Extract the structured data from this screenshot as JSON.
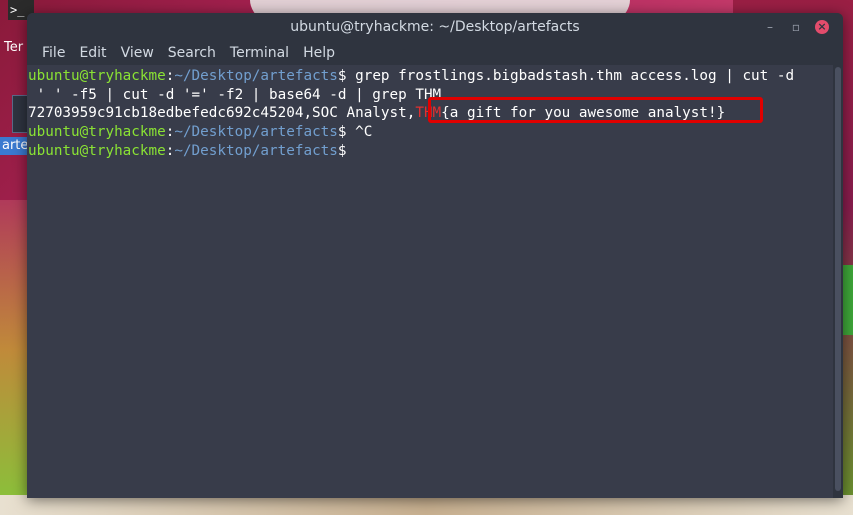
{
  "desktop": {
    "terminal_icon_label": "Ter",
    "terminal_icon_glyph": ">_",
    "folder_icon_label": "arte"
  },
  "window": {
    "title": "ubuntu@tryhackme: ~/Desktop/artefacts",
    "minimize_glyph": "–",
    "maximize_glyph": "▫",
    "close_glyph": "×"
  },
  "menu": [
    "File",
    "Edit",
    "View",
    "Search",
    "Terminal",
    "Help"
  ],
  "terminal": {
    "prompt_user": "ubuntu@tryhackme",
    "prompt_sep": ":",
    "prompt_path": "~/Desktop/artefacts",
    "prompt_dollar": "$",
    "cmd1_part1": " grep frostlings.bigbadstash.thm access.log | cut -d",
    "cmd1_part2": " ' ' -f5 | cut -d '=' -f2 | base64 -d | grep THM",
    "output_prefix": "72703959c91cb18edbefedc692c45204,SOC Analyst,",
    "output_thm": "THM",
    "output_flag": "{a_gift_for_you_awesome_analyst!}",
    "cmd2": " ^C",
    "cmd3": ""
  }
}
